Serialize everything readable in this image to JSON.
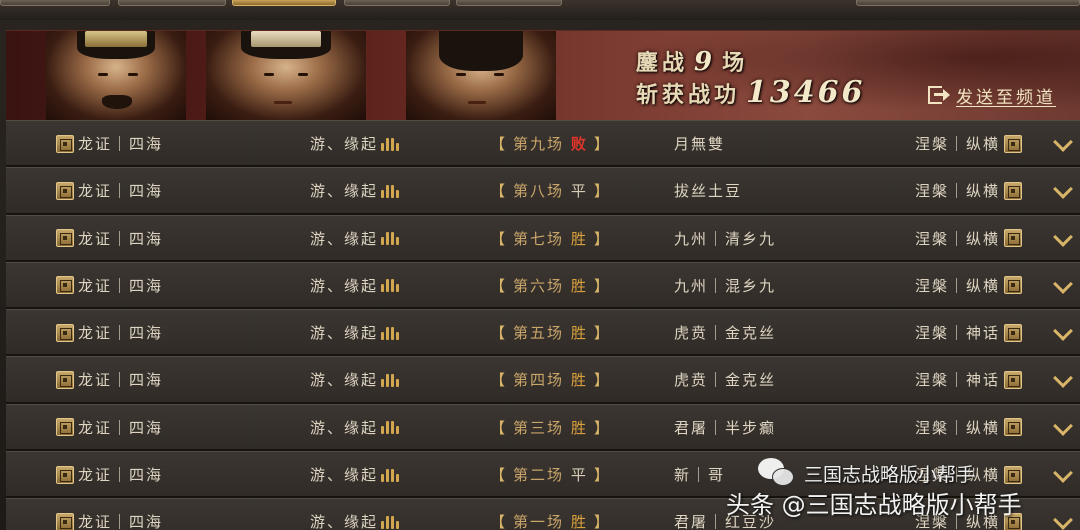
{
  "banner": {
    "battles_prefix": "鏖战",
    "battles_count": "9",
    "battles_suffix": "场",
    "merit_label": "斩获战功",
    "merit_value": "13466",
    "share_label": "发送至频道"
  },
  "icons": {
    "share": "share-icon",
    "badge": "league-badge-icon",
    "crest": "clan-crest-icon",
    "expand": "chevron-down-icon"
  },
  "colors": {
    "win": "#d9a13c",
    "lose": "#e0352a",
    "draw": "#d6cdb7",
    "accent": "#d9b56a"
  },
  "rows": [
    {
      "left_team": "龙证｜四海",
      "mid_team": "游、缘起",
      "round": "第九场",
      "result": "败",
      "opponent": "月無雙",
      "right_team": "涅槃｜纵横"
    },
    {
      "left_team": "龙证｜四海",
      "mid_team": "游、缘起",
      "round": "第八场",
      "result": "平",
      "opponent": "拔丝土豆",
      "right_team": "涅槃｜纵横"
    },
    {
      "left_team": "龙证｜四海",
      "mid_team": "游、缘起",
      "round": "第七场",
      "result": "胜",
      "opponent": "九州｜清乡九",
      "right_team": "涅槃｜纵横"
    },
    {
      "left_team": "龙证｜四海",
      "mid_team": "游、缘起",
      "round": "第六场",
      "result": "胜",
      "opponent": "九州｜混乡九",
      "right_team": "涅槃｜纵横"
    },
    {
      "left_team": "龙证｜四海",
      "mid_team": "游、缘起",
      "round": "第五场",
      "result": "胜",
      "opponent": "虎贲｜金克丝",
      "right_team": "涅槃｜神话"
    },
    {
      "left_team": "龙证｜四海",
      "mid_team": "游、缘起",
      "round": "第四场",
      "result": "胜",
      "opponent": "虎贲｜金克丝",
      "right_team": "涅槃｜神话"
    },
    {
      "left_team": "龙证｜四海",
      "mid_team": "游、缘起",
      "round": "第三场",
      "result": "胜",
      "opponent": "君屠｜半步癫",
      "right_team": "涅槃｜纵横"
    },
    {
      "left_team": "龙证｜四海",
      "mid_team": "游、缘起",
      "round": "第二场",
      "result": "平",
      "opponent": "新｜哥",
      "right_team": "涅槃｜纵横"
    },
    {
      "left_team": "龙证｜四海",
      "mid_team": "游、缘起",
      "round": "第一场",
      "result": "胜",
      "opponent": "君屠｜红豆沙",
      "right_team": "涅槃｜纵横"
    }
  ],
  "watermark": {
    "line1": "三国志战略版小帮手",
    "line2": "头条 @三国志战略版小帮手"
  }
}
